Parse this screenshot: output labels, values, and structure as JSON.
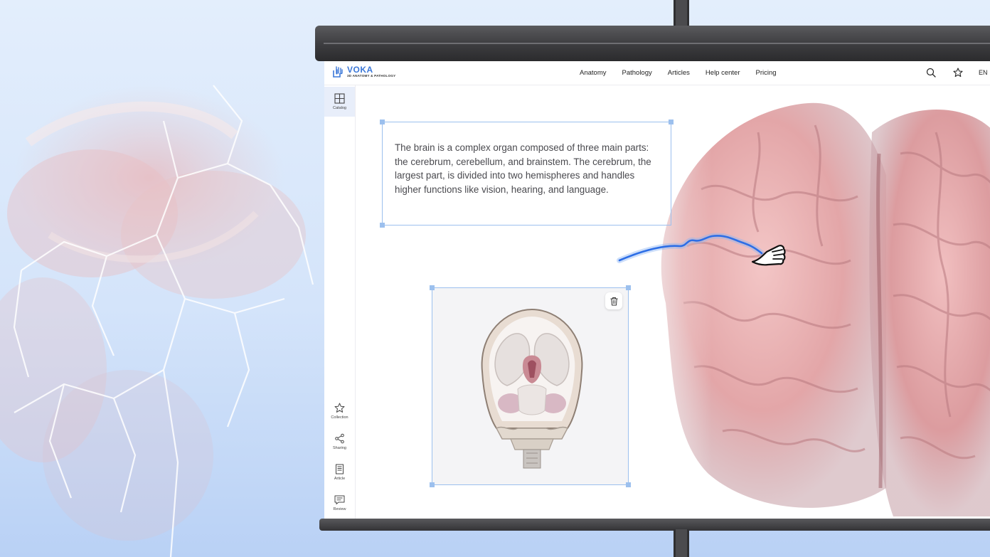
{
  "brand": {
    "name": "VOKA",
    "tagline": "3D ANATOMY & PATHOLOGY",
    "color": "#3c78d8"
  },
  "nav": {
    "items": [
      "Anatomy",
      "Pathology",
      "Articles",
      "Help center",
      "Pricing"
    ]
  },
  "header": {
    "search_icon": "search-icon",
    "favorite_icon": "star-icon",
    "language": "EN"
  },
  "sidebar": {
    "catalog": "Catalog",
    "collection": "Collection",
    "sharing": "Sharing",
    "article": "Article",
    "review": "Review"
  },
  "content": {
    "text_block": "The brain is a complex organ composed of three main parts: the cerebrum, cerebellum, and brainstem. The cerebrum, the largest part, is divided into two hemispheres and handles higher functions like vision, hearing, and language.",
    "image_block_icon": "trash-icon"
  },
  "colors": {
    "selection": "#9cc0ee",
    "annotation_stroke": "#2d6ee6"
  }
}
